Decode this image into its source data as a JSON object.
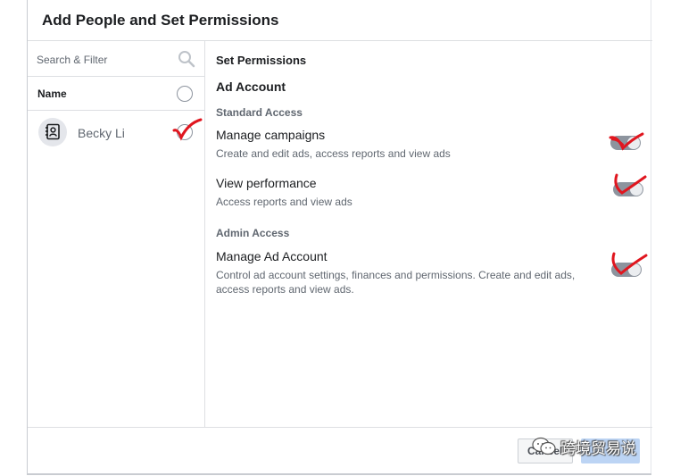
{
  "dialog": {
    "title": "Add People and Set Permissions"
  },
  "left_pane": {
    "search_placeholder": "Search & Filter",
    "name_header": "Name",
    "people": [
      {
        "name": "Becky Li",
        "selected": true
      }
    ]
  },
  "right_pane": {
    "section_title": "Set Permissions",
    "asset_title": "Ad Account",
    "groups": [
      {
        "title": "Standard Access",
        "permissions": [
          {
            "title": "Manage campaigns",
            "description": "Create and edit ads, access reports and view ads",
            "enabled": true
          },
          {
            "title": "View performance",
            "description": "Access reports and view ads",
            "enabled": true
          }
        ]
      },
      {
        "title": "Admin Access",
        "permissions": [
          {
            "title": "Manage Ad Account",
            "description": "Control ad account settings, finances and permissions. Create and edit ads, access reports and view ads.",
            "enabled": true
          }
        ]
      }
    ]
  },
  "footer": {
    "cancel_label": "Cancel",
    "confirm_label": ""
  },
  "watermark": {
    "text": "跨境贸易说"
  },
  "colors": {
    "annotation_red": "#e0161f",
    "confirm_button_disabled": "#bcd4f4",
    "toggle": "#8d949e"
  },
  "icons": {
    "search": "search-icon",
    "avatar": "user-contact-icon",
    "watermark": "wechat-icon",
    "annotation": "checkmark-annotation-icon"
  }
}
